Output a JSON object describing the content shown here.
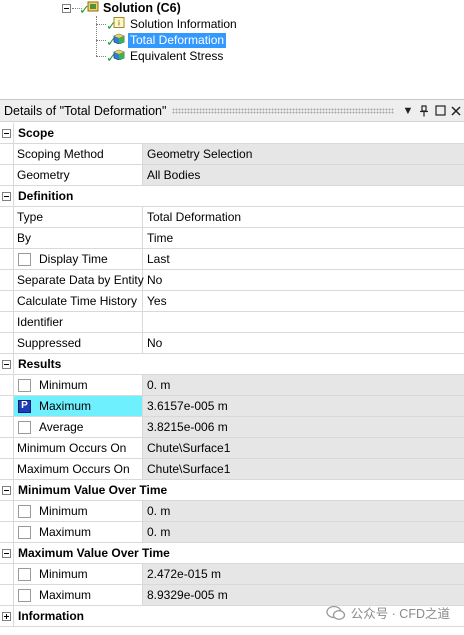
{
  "tree": {
    "solution": "Solution (C6)",
    "children": [
      "Solution Information",
      "Total Deformation",
      "Equivalent Stress"
    ],
    "selected_index": 1
  },
  "details": {
    "title": "Details of \"Total Deformation\"",
    "buttons": {
      "menu": "▼",
      "pin": "ᵽ",
      "restore": "□",
      "close": "✕"
    }
  },
  "groups": {
    "scope": {
      "label": "Scope",
      "rows": [
        {
          "name": "Scoping Method",
          "value": "Geometry Selection"
        },
        {
          "name": "Geometry",
          "value": "All Bodies"
        }
      ]
    },
    "definition": {
      "label": "Definition",
      "rows": [
        {
          "name": "Type",
          "value": "Total Deformation"
        },
        {
          "name": "By",
          "value": "Time"
        },
        {
          "name": "Display Time",
          "value": "Last"
        },
        {
          "name": "Separate Data by Entity",
          "value": "No"
        },
        {
          "name": "Calculate Time History",
          "value": "Yes"
        },
        {
          "name": "Identifier",
          "value": ""
        },
        {
          "name": "Suppressed",
          "value": "No"
        }
      ]
    },
    "results": {
      "label": "Results",
      "rows": [
        {
          "name": "Minimum",
          "value": "0. m"
        },
        {
          "name": "Maximum",
          "value": "3.6157e-005 m",
          "badge": "P"
        },
        {
          "name": "Average",
          "value": "3.8215e-006 m"
        },
        {
          "name": "Minimum Occurs On",
          "value": "Chute\\Surface1"
        },
        {
          "name": "Maximum Occurs On",
          "value": "Chute\\Surface1"
        }
      ]
    },
    "min_over_time": {
      "label": "Minimum Value Over Time",
      "rows": [
        {
          "name": "Minimum",
          "value": "0. m"
        },
        {
          "name": "Maximum",
          "value": "0. m"
        }
      ]
    },
    "max_over_time": {
      "label": "Maximum Value Over Time",
      "rows": [
        {
          "name": "Minimum",
          "value": "2.472e-015 m"
        },
        {
          "name": "Maximum",
          "value": "8.9329e-005 m"
        }
      ]
    },
    "information": {
      "label": "Information"
    }
  },
  "watermark": "公众号 · CFD之道",
  "colors": {
    "selection": "#3399ff",
    "highlight": "#6ff0ff",
    "readonly": "#e6e6e6",
    "check": "#2a9a2a"
  }
}
